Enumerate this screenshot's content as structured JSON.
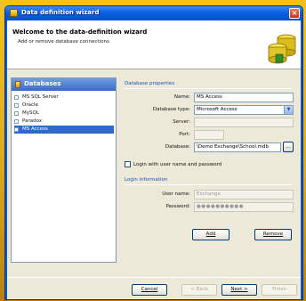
{
  "window": {
    "title": "Data definition wizard",
    "close_glyph": "×"
  },
  "header": {
    "title": "Welcome to the data-definition wizard",
    "subtitle": "Add or remove database connections",
    "icon": "database-stack-icon"
  },
  "databases": {
    "header_label": "Databases",
    "items": [
      {
        "label": "MS SQL Server",
        "selected": false
      },
      {
        "label": "Oracle",
        "selected": false
      },
      {
        "label": "MySQL",
        "selected": false
      },
      {
        "label": "Paradox",
        "selected": false
      },
      {
        "label": "MS Access",
        "selected": true
      }
    ]
  },
  "properties": {
    "group_label": "Database properties",
    "name_label": "Name:",
    "name_value": "MS Access",
    "type_label": "Database type:",
    "type_value": "Microsoft Access",
    "server_label": "Server:",
    "server_value": "",
    "port_label": "Port:",
    "port_value": "",
    "database_label": "Database:",
    "database_value": "\\Demo Exchange\\School.mdb",
    "browse_label": "..."
  },
  "login": {
    "checkbox_label": "Login with user name and password",
    "checked": false,
    "group_label": "Login information",
    "username_label": "User name:",
    "username_value": "Exchange",
    "password_label": "Password:",
    "password_value": "●●●●●●●●●●"
  },
  "actions": {
    "add_label": "Add",
    "remove_label": "Remove"
  },
  "footer": {
    "cancel_label": "Cancel",
    "back_label": "< Back",
    "next_label": "Next >",
    "finish_label": "Finish"
  },
  "colors": {
    "title_bar": "#0a5fe0",
    "selection": "#316ac5",
    "frame": "#e4a812"
  }
}
